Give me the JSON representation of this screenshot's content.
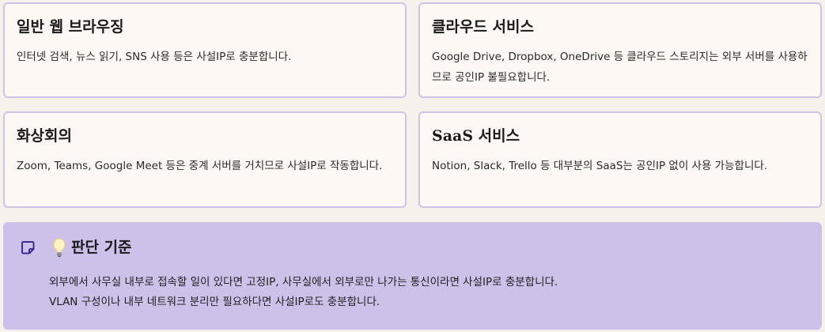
{
  "cards": [
    {
      "title": "일반 웹 브라우징",
      "description": "인터넷 검색, 뉴스 읽기, SNS 사용 등은 사설IP로 충분합니다."
    },
    {
      "title": "클라우드 서비스",
      "description": "Google Drive, Dropbox, OneDrive 등 클라우드 스토리지는 외부 서버를 사용하므로 공인IP 불필요합니다."
    },
    {
      "title": "화상회의",
      "description": "Zoom, Teams, Google Meet 등은 중계 서버를 거치므로 사설IP로 작동합니다."
    },
    {
      "title": "SaaS 서비스",
      "description": "Notion, Slack, Trello 등 대부분의 SaaS는 공인IP 없이 사용 가능합니다."
    }
  ],
  "callout": {
    "icon": "note-icon",
    "emoji_icon": "lightbulb-icon",
    "title": "판단 기준",
    "lines": [
      "외부에서 사무실 내부로 접속할 일이 있다면 고정IP, 사무실에서 외부로만 나가는 통신이라면 사설IP로 충분합니다.",
      "VLAN 구성이나 내부 네트워크 분리만 필요하다면 사설IP로도 충분합니다."
    ]
  },
  "colors": {
    "card_border": "#cfc3e6",
    "card_bg": "#fdf8f4",
    "callout_bg": "#cdc1ea",
    "page_bg": "#f7f1ec",
    "note_icon": "#3b2d8a"
  }
}
